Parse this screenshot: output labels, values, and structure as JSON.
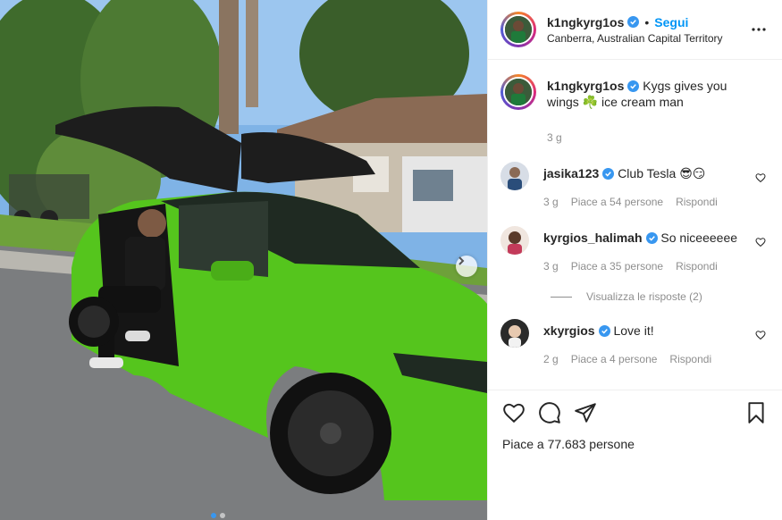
{
  "header": {
    "username": "k1ngkyrg1os",
    "separator": "•",
    "follow_label": "Segui",
    "location": "Canberra, Australian Capital Territory"
  },
  "caption": {
    "username": "k1ngkyrg1os",
    "text": "Kygs gives you wings ☘️ ice cream man",
    "time": "3 g"
  },
  "comments": [
    {
      "username": "jasika123",
      "text": "Club Tesla 😎😏",
      "time": "3 g",
      "likes": "Piace a 54 persone",
      "reply": "Rispondi"
    },
    {
      "username": "kyrgios_halimah",
      "text": "So niceeeeee",
      "time": "3 g",
      "likes": "Piace a 35 persone",
      "reply": "Rispondi"
    },
    {
      "username": "xkyrgios",
      "text": "Love it!",
      "time": "2 g",
      "likes": "Piace a 4 persone",
      "reply": "Rispondi"
    }
  ],
  "view_replies": "Visualizza le risposte (2)",
  "likes_total": "Piace a 77.683 persone",
  "colors": {
    "accent": "#0095f6",
    "verified": "#3897f0",
    "car": "#55c51d"
  },
  "icons": [
    "heart-icon",
    "comment-icon",
    "share-icon",
    "bookmark-icon",
    "more-icon",
    "chevron-right-icon",
    "verified-icon"
  ]
}
